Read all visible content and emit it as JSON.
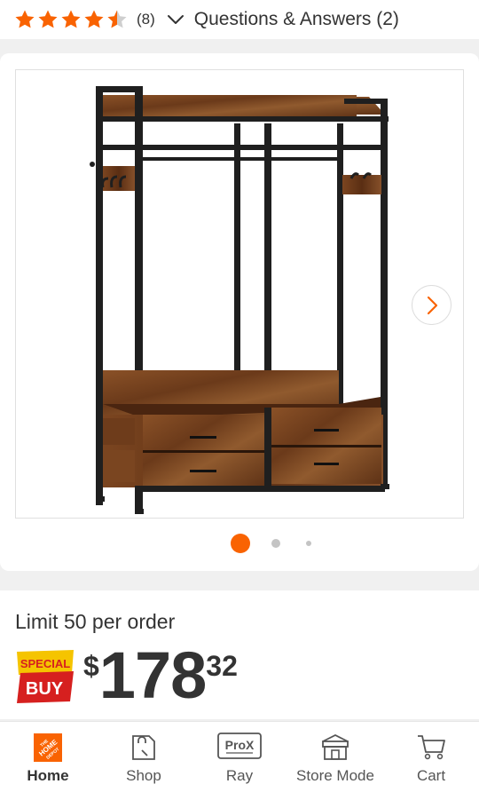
{
  "rating": {
    "stars": 4.5,
    "review_count": "(8)",
    "qa_label": "Questions & Answers (2)"
  },
  "gallery": {
    "image_alt": "Freestanding metal clothes rack with rustic brown wood shelf and drawers",
    "current_slide": 1,
    "slide_count": 3
  },
  "price_block": {
    "limit_text": "Limit 50 per order",
    "badge_top": "SPECIAL",
    "badge_bottom": "BUY",
    "currency": "$",
    "whole": "178",
    "cents": "32"
  },
  "nav": {
    "items": [
      {
        "label": "Home",
        "icon": "home-depot-logo-icon",
        "active": true
      },
      {
        "label": "Shop",
        "icon": "shop-bag-icon",
        "active": false
      },
      {
        "label": "Ray",
        "icon": "prox-icon",
        "active": false
      },
      {
        "label": "Store Mode",
        "icon": "store-icon",
        "active": false
      },
      {
        "label": "Cart",
        "icon": "cart-icon",
        "active": false
      }
    ],
    "prox_text": "ProX"
  },
  "colors": {
    "accent": "#f96302",
    "star": "#f96302",
    "badge_yellow": "#f5c400",
    "badge_red": "#d6201f",
    "wood": "#7a4521",
    "frame": "#1f1f1f"
  }
}
